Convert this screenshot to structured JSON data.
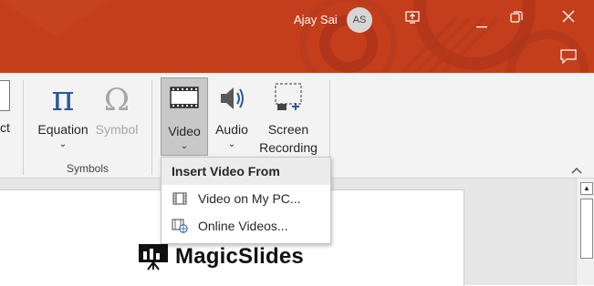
{
  "titlebar": {
    "user_name": "Ajay Sai",
    "avatar_initials": "AS",
    "background_color": "#c43e1c"
  },
  "ribbon": {
    "partial_label": "ct",
    "buttons": {
      "equation": "Equation",
      "symbol": "Symbol",
      "video": "Video",
      "audio": "Audio",
      "screen_recording_line1": "Screen",
      "screen_recording_line2": "Recording"
    },
    "group_label": "Symbols"
  },
  "dropdown": {
    "header": "Insert Video From",
    "items": [
      {
        "label": "Video on My PC...",
        "icon": "film-strip-icon"
      },
      {
        "label": "Online Videos...",
        "icon": "online-video-icon"
      }
    ]
  },
  "slide": {
    "brand_text": "MagicSlides"
  }
}
